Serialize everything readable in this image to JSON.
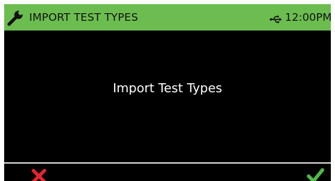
{
  "header": {
    "title": "IMPORT TEST TYPES",
    "time": "12:00PM",
    "icons": {
      "left": "wrench-icon",
      "status": "usb-icon"
    },
    "background_color": "#6cbd50"
  },
  "main": {
    "message": "Import Test Types",
    "background_color": "#000000"
  },
  "footer": {
    "cancel_icon": "x-icon",
    "confirm_icon": "check-icon",
    "cancel_color": "#e0262f",
    "confirm_color": "#4fb84a"
  }
}
